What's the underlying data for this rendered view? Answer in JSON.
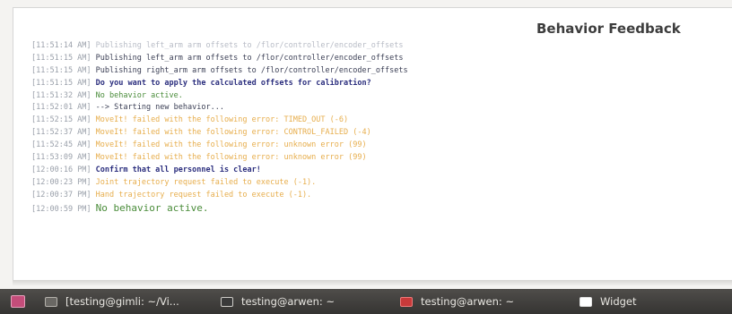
{
  "panel": {
    "title": "Behavior Feedback"
  },
  "log": [
    {
      "ts": "[11:51:14 AM]",
      "msg": "Publishing left_arm arm offsets to /flor/controller/encoder_offsets",
      "style": "cut"
    },
    {
      "ts": "[11:51:15 AM]",
      "msg": "Publishing left_arm arm offsets to /flor/controller/encoder_offsets",
      "style": "info"
    },
    {
      "ts": "[11:51:15 AM]",
      "msg": "Publishing right_arm arm offsets to /flor/controller/encoder_offsets",
      "style": "info"
    },
    {
      "ts": "[11:51:15 AM]",
      "msg": "Do you want to apply the calculated offsets for calibration?",
      "style": "bold"
    },
    {
      "ts": "[11:51:32 AM]",
      "msg": "No behavior active.",
      "style": "green"
    },
    {
      "ts": "[11:52:01 AM]",
      "msg": "--> Starting new behavior...",
      "style": "info"
    },
    {
      "ts": "[11:52:15 AM]",
      "msg": "MoveIt! failed with the following error: TIMED_OUT (-6)",
      "style": "warn"
    },
    {
      "ts": "[11:52:37 AM]",
      "msg": "MoveIt! failed with the following error: CONTROL_FAILED (-4)",
      "style": "warn"
    },
    {
      "ts": "[11:52:45 AM]",
      "msg": "MoveIt! failed with the following error: unknown error (99)",
      "style": "warn"
    },
    {
      "ts": "[11:53:09 AM]",
      "msg": "MoveIt! failed with the following error: unknown error (99)",
      "style": "warn"
    },
    {
      "ts": "[12:00:16 PM]",
      "msg": "Confirm that all personnel is clear!",
      "style": "bold"
    },
    {
      "ts": "[12:00:23 PM]",
      "msg": "Joint trajectory request failed to execute (-1).",
      "style": "warn"
    },
    {
      "ts": "[12:00:37 PM]",
      "msg": "Hand trajectory request failed to execute (-1).",
      "style": "warn"
    },
    {
      "ts": "[12:00:59 PM]",
      "msg": "No behavior active.",
      "style": "green"
    }
  ],
  "taskbar": {
    "tasks": [
      {
        "label": "[testing@gimli: ~/Vi...",
        "icon": "terminal-icon"
      },
      {
        "label": "testing@arwen: ~",
        "icon": "terminal-icon"
      },
      {
        "label": "testing@arwen: ~",
        "icon": "terminal-red-icon"
      },
      {
        "label": "Widget",
        "icon": "window-icon"
      }
    ]
  },
  "colors": {
    "timestamp": "#9aa0aa",
    "info": "#3b3f55",
    "bold": "#2b2e7e",
    "active": "#4a8c3a",
    "warning": "#e7ae4d",
    "taskbar": "#403e3b"
  }
}
